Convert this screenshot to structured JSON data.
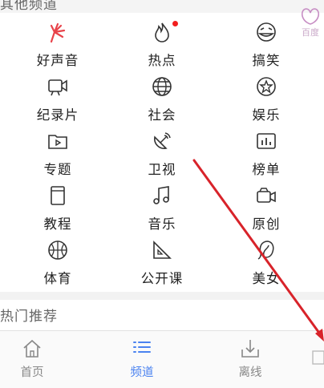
{
  "section_title_partial": "其他频道",
  "corner_logo_text": "百度",
  "channels": [
    {
      "label": "好声音",
      "icon": "voice-hand-icon",
      "dot": false
    },
    {
      "label": "热点",
      "icon": "flame-icon",
      "dot": true
    },
    {
      "label": "搞笑",
      "icon": "laugh-face-icon",
      "dot": false
    },
    {
      "label": "纪录片",
      "icon": "video-camera-icon",
      "dot": false
    },
    {
      "label": "社会",
      "icon": "globe-icon",
      "dot": false
    },
    {
      "label": "娱乐",
      "icon": "star-badge-icon",
      "dot": false
    },
    {
      "label": "专题",
      "icon": "folder-play-icon",
      "dot": false
    },
    {
      "label": "卫视",
      "icon": "satellite-icon",
      "dot": false
    },
    {
      "label": "榜单",
      "icon": "ranking-bars-icon",
      "dot": false
    },
    {
      "label": "教程",
      "icon": "book-icon",
      "dot": false
    },
    {
      "label": "音乐",
      "icon": "music-note-icon",
      "dot": false
    },
    {
      "label": "原创",
      "icon": "camcorder-icon",
      "dot": false
    },
    {
      "label": "体育",
      "icon": "basketball-icon",
      "dot": false
    },
    {
      "label": "公开课",
      "icon": "set-square-icon",
      "dot": false
    },
    {
      "label": "美女",
      "icon": "lady-face-icon",
      "dot": false
    }
  ],
  "hot_recommend_partial": "热门推荐",
  "tabbar": [
    {
      "label": "首页",
      "icon": "home-icon",
      "active": false
    },
    {
      "label": "频道",
      "icon": "list-icon",
      "active": true
    },
    {
      "label": "离线",
      "icon": "download-icon",
      "active": false
    }
  ],
  "colors": {
    "active": "#4a82f0",
    "inactive": "#888888",
    "hot_dot": "#f21e1e",
    "annotation_arrow": "#d8232a"
  }
}
